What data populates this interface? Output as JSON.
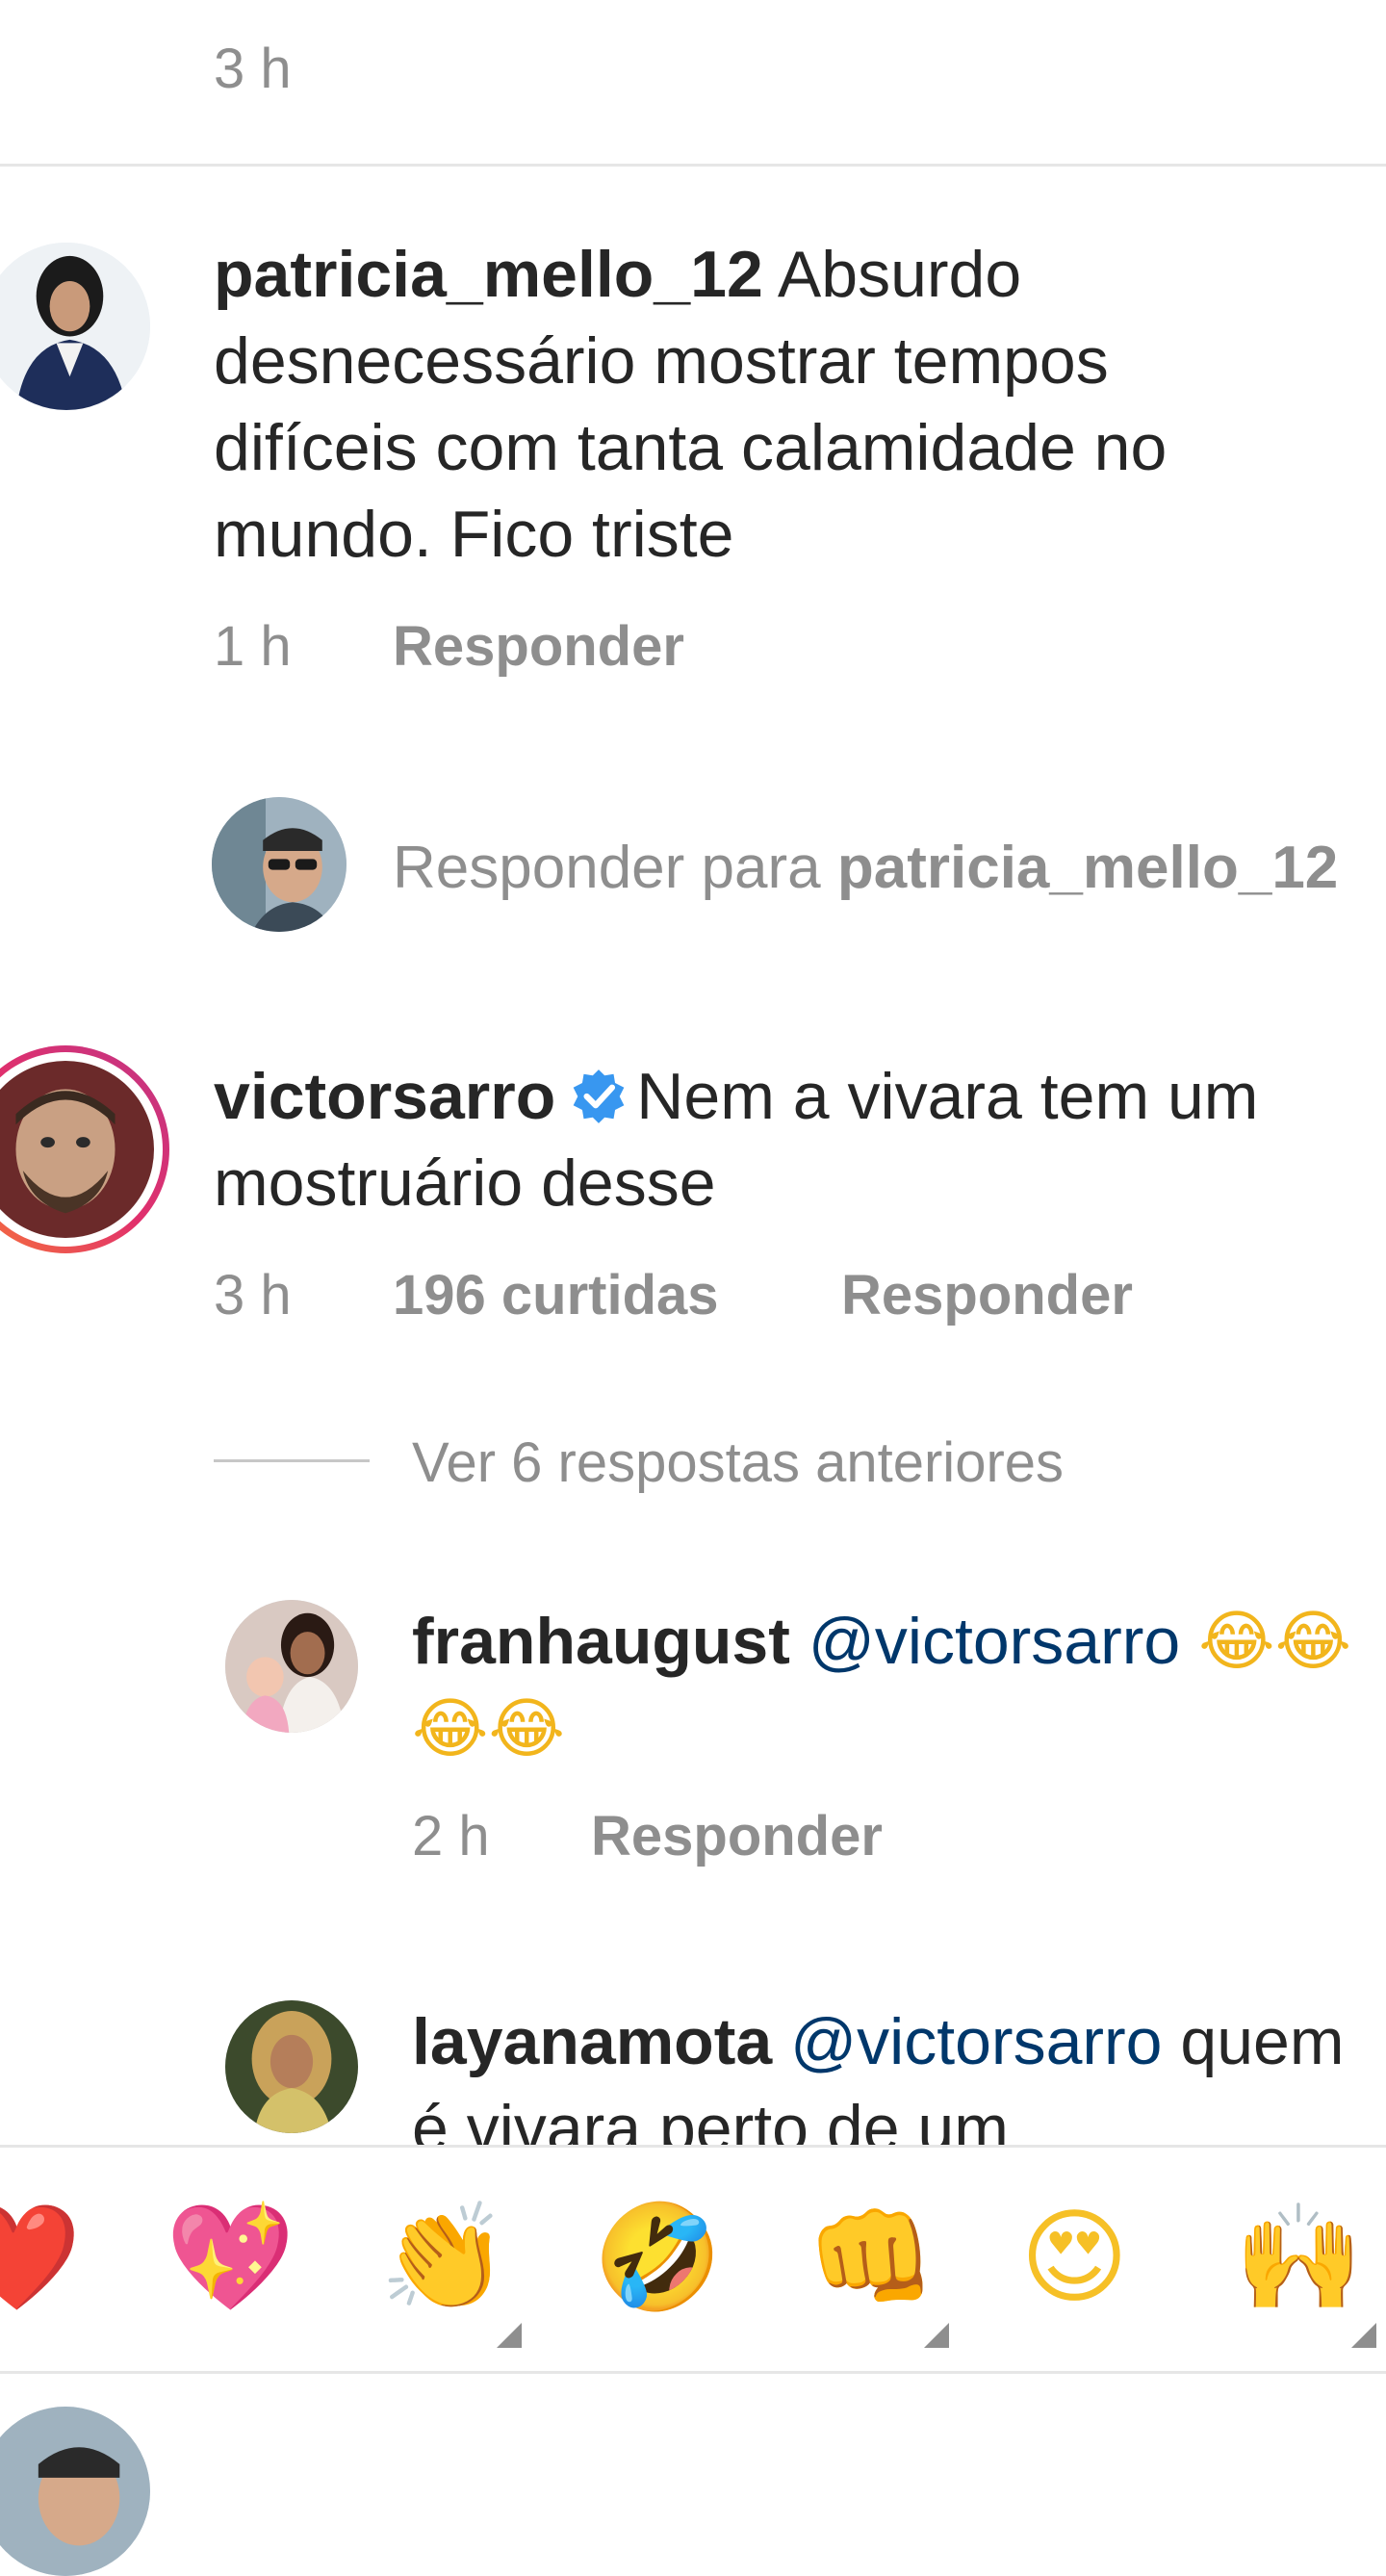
{
  "previous_comment": {
    "time": "3 h"
  },
  "comments": [
    {
      "username": "patricia_mello_12",
      "text": "Absurdo desnecessário mostrar tempos difíceis com tanta calamidade no mundo. Fico triste",
      "time": "1 h",
      "reply_label": "Responder"
    },
    {
      "username": "victorsarro",
      "verified": true,
      "text": "Nem a vivara tem um mostruário desse",
      "time": "3 h",
      "likes": "196 curtidas",
      "reply_label": "Responder",
      "view_replies": "Ver 6 respostas anteriores",
      "replies": [
        {
          "username": "franhaugust",
          "mention": "@victorsarro",
          "text": "😂😂😂😂",
          "time": "2 h",
          "reply_label": "Responder"
        },
        {
          "username": "layanamota",
          "mention": "@victorsarro",
          "text": "quem é vivara perto de um"
        }
      ]
    }
  ],
  "reply_prompt": {
    "prefix": "Responder para",
    "target": "patricia_mello_12"
  },
  "emoji_bar": [
    "❤️",
    "💖",
    "👏",
    "🤣",
    "👊",
    "😍",
    "🙌"
  ],
  "colors": {
    "text": "#262626",
    "secondary": "#8e8e8e",
    "mention": "#00376b",
    "verified": "#3897f0",
    "story_ring_start": "#c13584",
    "story_ring_end": "#f77737"
  }
}
